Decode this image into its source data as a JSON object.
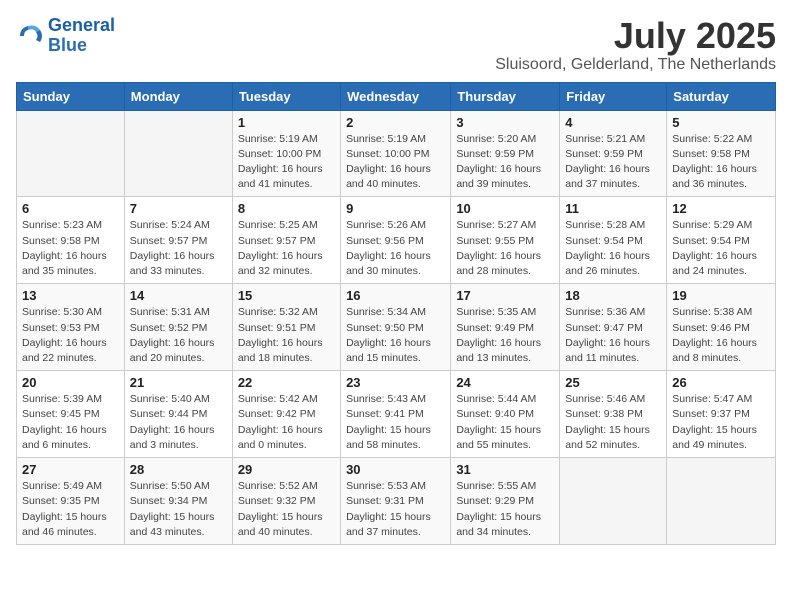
{
  "logo": {
    "line1": "General",
    "line2": "Blue"
  },
  "title": "July 2025",
  "location": "Sluisoord, Gelderland, The Netherlands",
  "headers": [
    "Sunday",
    "Monday",
    "Tuesday",
    "Wednesday",
    "Thursday",
    "Friday",
    "Saturday"
  ],
  "weeks": [
    [
      {
        "day": "",
        "info": ""
      },
      {
        "day": "",
        "info": ""
      },
      {
        "day": "1",
        "info": "Sunrise: 5:19 AM\nSunset: 10:00 PM\nDaylight: 16 hours and 41 minutes."
      },
      {
        "day": "2",
        "info": "Sunrise: 5:19 AM\nSunset: 10:00 PM\nDaylight: 16 hours and 40 minutes."
      },
      {
        "day": "3",
        "info": "Sunrise: 5:20 AM\nSunset: 9:59 PM\nDaylight: 16 hours and 39 minutes."
      },
      {
        "day": "4",
        "info": "Sunrise: 5:21 AM\nSunset: 9:59 PM\nDaylight: 16 hours and 37 minutes."
      },
      {
        "day": "5",
        "info": "Sunrise: 5:22 AM\nSunset: 9:58 PM\nDaylight: 16 hours and 36 minutes."
      }
    ],
    [
      {
        "day": "6",
        "info": "Sunrise: 5:23 AM\nSunset: 9:58 PM\nDaylight: 16 hours and 35 minutes."
      },
      {
        "day": "7",
        "info": "Sunrise: 5:24 AM\nSunset: 9:57 PM\nDaylight: 16 hours and 33 minutes."
      },
      {
        "day": "8",
        "info": "Sunrise: 5:25 AM\nSunset: 9:57 PM\nDaylight: 16 hours and 32 minutes."
      },
      {
        "day": "9",
        "info": "Sunrise: 5:26 AM\nSunset: 9:56 PM\nDaylight: 16 hours and 30 minutes."
      },
      {
        "day": "10",
        "info": "Sunrise: 5:27 AM\nSunset: 9:55 PM\nDaylight: 16 hours and 28 minutes."
      },
      {
        "day": "11",
        "info": "Sunrise: 5:28 AM\nSunset: 9:54 PM\nDaylight: 16 hours and 26 minutes."
      },
      {
        "day": "12",
        "info": "Sunrise: 5:29 AM\nSunset: 9:54 PM\nDaylight: 16 hours and 24 minutes."
      }
    ],
    [
      {
        "day": "13",
        "info": "Sunrise: 5:30 AM\nSunset: 9:53 PM\nDaylight: 16 hours and 22 minutes."
      },
      {
        "day": "14",
        "info": "Sunrise: 5:31 AM\nSunset: 9:52 PM\nDaylight: 16 hours and 20 minutes."
      },
      {
        "day": "15",
        "info": "Sunrise: 5:32 AM\nSunset: 9:51 PM\nDaylight: 16 hours and 18 minutes."
      },
      {
        "day": "16",
        "info": "Sunrise: 5:34 AM\nSunset: 9:50 PM\nDaylight: 16 hours and 15 minutes."
      },
      {
        "day": "17",
        "info": "Sunrise: 5:35 AM\nSunset: 9:49 PM\nDaylight: 16 hours and 13 minutes."
      },
      {
        "day": "18",
        "info": "Sunrise: 5:36 AM\nSunset: 9:47 PM\nDaylight: 16 hours and 11 minutes."
      },
      {
        "day": "19",
        "info": "Sunrise: 5:38 AM\nSunset: 9:46 PM\nDaylight: 16 hours and 8 minutes."
      }
    ],
    [
      {
        "day": "20",
        "info": "Sunrise: 5:39 AM\nSunset: 9:45 PM\nDaylight: 16 hours and 6 minutes."
      },
      {
        "day": "21",
        "info": "Sunrise: 5:40 AM\nSunset: 9:44 PM\nDaylight: 16 hours and 3 minutes."
      },
      {
        "day": "22",
        "info": "Sunrise: 5:42 AM\nSunset: 9:42 PM\nDaylight: 16 hours and 0 minutes."
      },
      {
        "day": "23",
        "info": "Sunrise: 5:43 AM\nSunset: 9:41 PM\nDaylight: 15 hours and 58 minutes."
      },
      {
        "day": "24",
        "info": "Sunrise: 5:44 AM\nSunset: 9:40 PM\nDaylight: 15 hours and 55 minutes."
      },
      {
        "day": "25",
        "info": "Sunrise: 5:46 AM\nSunset: 9:38 PM\nDaylight: 15 hours and 52 minutes."
      },
      {
        "day": "26",
        "info": "Sunrise: 5:47 AM\nSunset: 9:37 PM\nDaylight: 15 hours and 49 minutes."
      }
    ],
    [
      {
        "day": "27",
        "info": "Sunrise: 5:49 AM\nSunset: 9:35 PM\nDaylight: 15 hours and 46 minutes."
      },
      {
        "day": "28",
        "info": "Sunrise: 5:50 AM\nSunset: 9:34 PM\nDaylight: 15 hours and 43 minutes."
      },
      {
        "day": "29",
        "info": "Sunrise: 5:52 AM\nSunset: 9:32 PM\nDaylight: 15 hours and 40 minutes."
      },
      {
        "day": "30",
        "info": "Sunrise: 5:53 AM\nSunset: 9:31 PM\nDaylight: 15 hours and 37 minutes."
      },
      {
        "day": "31",
        "info": "Sunrise: 5:55 AM\nSunset: 9:29 PM\nDaylight: 15 hours and 34 minutes."
      },
      {
        "day": "",
        "info": ""
      },
      {
        "day": "",
        "info": ""
      }
    ]
  ]
}
